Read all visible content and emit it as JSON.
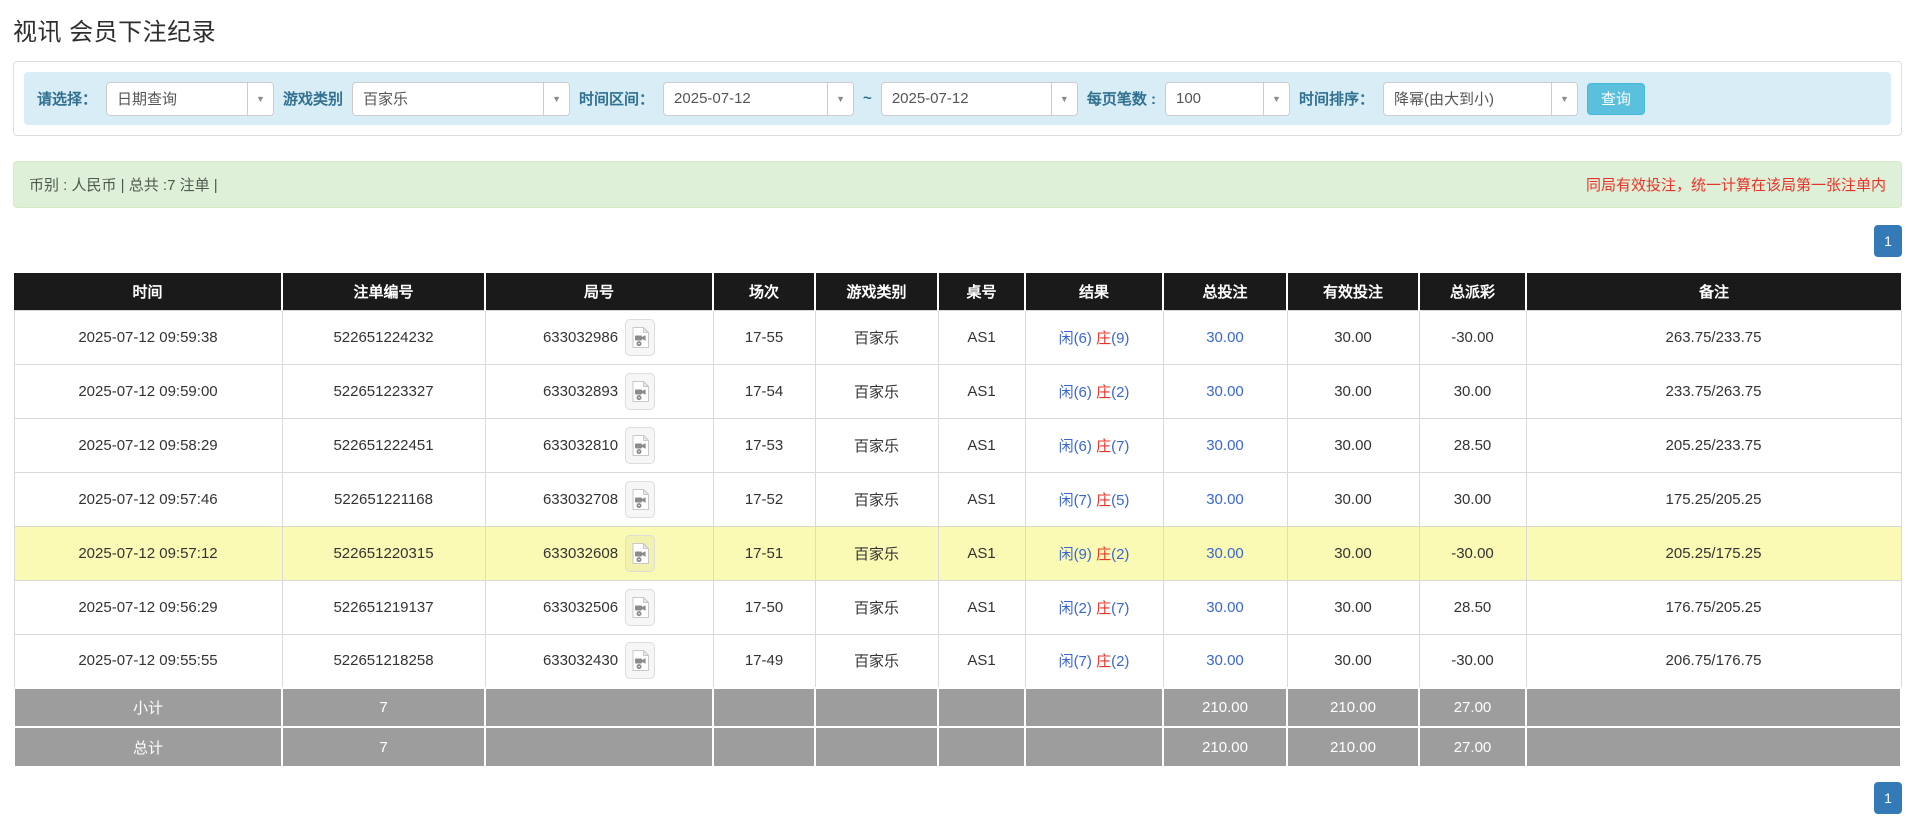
{
  "page": {
    "title": "视讯 会员下注纪录"
  },
  "filters": {
    "select_label": "请选择：",
    "select_value": "日期查询",
    "game_type_label": "游戏类别",
    "game_type_value": "百家乐",
    "time_range_label": "时间区间：",
    "date_from": "2025-07-12",
    "date_tilde": "~",
    "date_to": "2025-07-12",
    "page_size_label": "每页笔数 :",
    "page_size_value": "100",
    "sort_label": "时间排序：",
    "sort_value": "降幂(由大到小)",
    "search_button": "查询"
  },
  "summary": {
    "left_text": "币别 : 人民币 | 总共 :7 注单 |",
    "right_notice": "同局有效投注，统一计算在该局第一张注单内"
  },
  "pagination": {
    "page": "1"
  },
  "icons": {
    "combo_arrow": "chevron-down-icon ▼",
    "round_cell": "video-replay-icon (document with film camera)"
  },
  "colors": {
    "filter_bar_bg": "#d9edf7",
    "filter_label": "#31708f",
    "search_button_bg": "#5bc0de",
    "summary_bg": "#dff0d8",
    "notice_red": "#e8332a",
    "header_bg": "#1a1a1a",
    "totals_bg": "#9d9d9d",
    "highlight_row_bg": "#fbfab4",
    "link_blue": "#3a67cf",
    "pagination_blue": "#337ab7"
  },
  "table": {
    "headers": [
      "时间",
      "注单编号",
      "局号",
      "场次",
      "游戏类别",
      "桌号",
      "结果",
      "总投注",
      "有效投注",
      "总派彩",
      "备注"
    ],
    "rows": [
      {
        "time": "2025-07-12 09:59:38",
        "bet_id": "522651224232",
        "round": "633032986",
        "session": "17-55",
        "game": "百家乐",
        "table_no": "AS1",
        "result_player": "闲(6)",
        "result_banker_label": "庄",
        "result_banker_score": "(9)",
        "total_bet": "30.00",
        "valid_bet": "30.00",
        "payout": "-30.00",
        "note": "263.75/233.75",
        "highlight": false
      },
      {
        "time": "2025-07-12 09:59:00",
        "bet_id": "522651223327",
        "round": "633032893",
        "session": "17-54",
        "game": "百家乐",
        "table_no": "AS1",
        "result_player": "闲(6)",
        "result_banker_label": "庄",
        "result_banker_score": "(2)",
        "total_bet": "30.00",
        "valid_bet": "30.00",
        "payout": "30.00",
        "note": "233.75/263.75",
        "highlight": false
      },
      {
        "time": "2025-07-12 09:58:29",
        "bet_id": "522651222451",
        "round": "633032810",
        "session": "17-53",
        "game": "百家乐",
        "table_no": "AS1",
        "result_player": "闲(6)",
        "result_banker_label": "庄",
        "result_banker_score": "(7)",
        "total_bet": "30.00",
        "valid_bet": "30.00",
        "payout": "28.50",
        "note": "205.25/233.75",
        "highlight": false
      },
      {
        "time": "2025-07-12 09:57:46",
        "bet_id": "522651221168",
        "round": "633032708",
        "session": "17-52",
        "game": "百家乐",
        "table_no": "AS1",
        "result_player": "闲(7)",
        "result_banker_label": "庄",
        "result_banker_score": "(5)",
        "total_bet": "30.00",
        "valid_bet": "30.00",
        "payout": "30.00",
        "note": "175.25/205.25",
        "highlight": false
      },
      {
        "time": "2025-07-12 09:57:12",
        "bet_id": "522651220315",
        "round": "633032608",
        "session": "17-51",
        "game": "百家乐",
        "table_no": "AS1",
        "result_player": "闲(9)",
        "result_banker_label": "庄",
        "result_banker_score": "(2)",
        "total_bet": "30.00",
        "valid_bet": "30.00",
        "payout": "-30.00",
        "note": "205.25/175.25",
        "highlight": true
      },
      {
        "time": "2025-07-12 09:56:29",
        "bet_id": "522651219137",
        "round": "633032506",
        "session": "17-50",
        "game": "百家乐",
        "table_no": "AS1",
        "result_player": "闲(2)",
        "result_banker_label": "庄",
        "result_banker_score": "(7)",
        "total_bet": "30.00",
        "valid_bet": "30.00",
        "payout": "28.50",
        "note": "176.75/205.25",
        "highlight": false
      },
      {
        "time": "2025-07-12 09:55:55",
        "bet_id": "522651218258",
        "round": "633032430",
        "session": "17-49",
        "game": "百家乐",
        "table_no": "AS1",
        "result_player": "闲(7)",
        "result_banker_label": "庄",
        "result_banker_score": "(2)",
        "total_bet": "30.00",
        "valid_bet": "30.00",
        "payout": "-30.00",
        "note": "206.75/176.75",
        "highlight": false
      }
    ],
    "subtotal": {
      "label": "小计",
      "count": "7",
      "total_bet": "210.00",
      "valid_bet": "210.00",
      "payout": "27.00"
    },
    "total": {
      "label": "总计",
      "count": "7",
      "total_bet": "210.00",
      "valid_bet": "210.00",
      "payout": "27.00"
    }
  }
}
